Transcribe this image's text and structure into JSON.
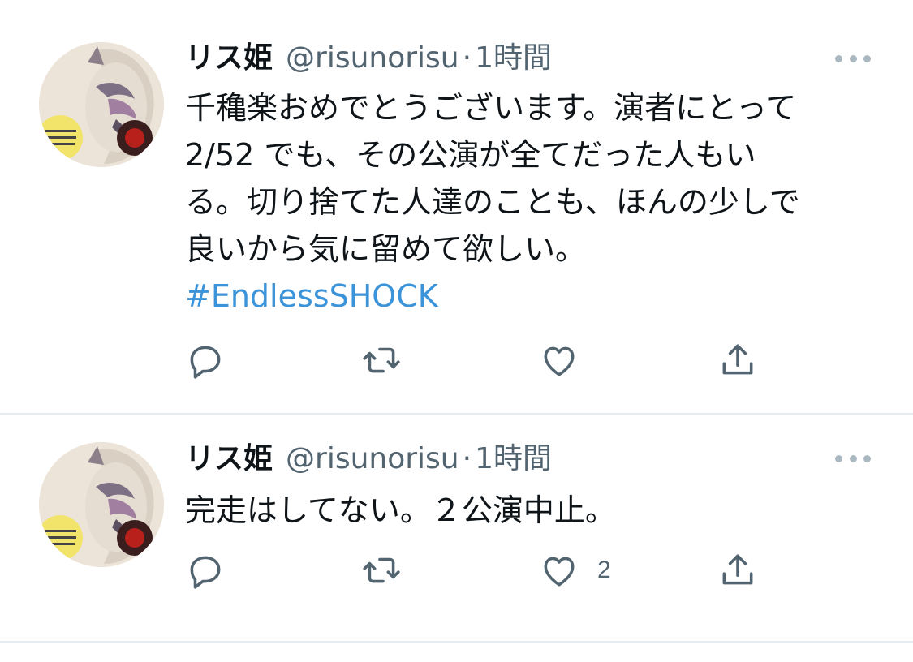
{
  "tweets": [
    {
      "display_name": "リス姫",
      "handle": "@risunorisu",
      "separator": "·",
      "time": "1時間",
      "text_lines": [
        "千穐楽おめでとうございます。演者にとって",
        "2/52 でも、その公演が全てだった人もい",
        "る。切り捨てた人達のことも、ほんの少しで",
        "良いから気に留めて欲しい。"
      ],
      "hashtag": "#EndlessSHOCK",
      "like_count": "",
      "icons": {
        "reply": "reply-icon",
        "retweet": "retweet-icon",
        "like": "heart-icon",
        "share": "share-icon",
        "more": "more-icon"
      }
    },
    {
      "display_name": "リス姫",
      "handle": "@risunorisu",
      "separator": "·",
      "time": "1時間",
      "text_lines": [
        "完走はしてない。２公演中止。"
      ],
      "like_count": "2",
      "icons": {
        "reply": "reply-icon",
        "retweet": "retweet-icon",
        "like": "heart-icon",
        "share": "share-icon",
        "more": "more-icon"
      }
    }
  ],
  "colors": {
    "text": "#0f1419",
    "secondary": "#536471",
    "link": "#3b94d9",
    "divider": "#e6ecf0"
  }
}
